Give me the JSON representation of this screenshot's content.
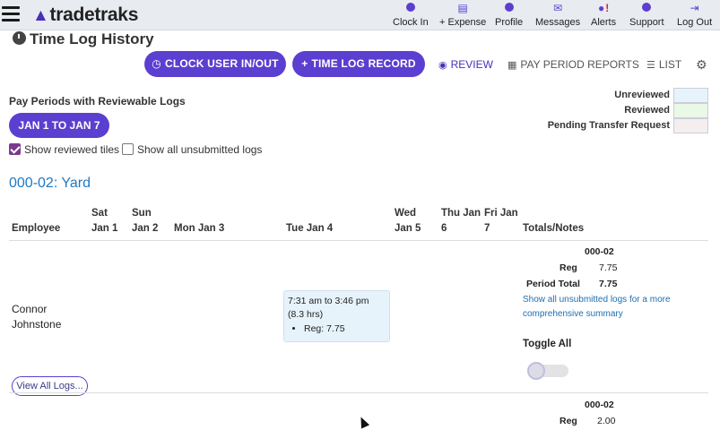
{
  "app": {
    "logo_text": "tradetraks"
  },
  "nav": [
    {
      "label": "Clock In",
      "icon": "clock-icon"
    },
    {
      "label": "+ Expense",
      "icon": "receipt-icon"
    },
    {
      "label": "Profile",
      "icon": "user-icon"
    },
    {
      "label": "Messages",
      "icon": "envelope-icon"
    },
    {
      "label": "Alerts",
      "icon": "bell-icon",
      "badge": "!"
    },
    {
      "label": "Support",
      "icon": "question-icon"
    },
    {
      "label": "Log Out",
      "icon": "logout-icon"
    }
  ],
  "page": {
    "title": "Time Log History"
  },
  "actions": {
    "clock_user": "CLOCK USER IN/OUT",
    "time_log_record": "TIME LOG RECORD",
    "review": "REVIEW",
    "pay_period_reports": "PAY PERIOD REPORTS",
    "list": "LIST"
  },
  "pay_periods": {
    "label": "Pay Periods with Reviewable Logs",
    "selected": "JAN 1 TO JAN 7",
    "show_reviewed": "Show reviewed tiles",
    "show_unsubmitted": "Show all unsubmitted logs",
    "show_reviewed_checked": true,
    "show_unsubmitted_checked": false
  },
  "legend": [
    {
      "label": "Unreviewed",
      "color": "#e6f3fb"
    },
    {
      "label": "Reviewed",
      "color": "#eaf8e6"
    },
    {
      "label": "Pending Transfer Request",
      "color": "#f4eeee"
    }
  ],
  "project": {
    "name": "000-02: Yard"
  },
  "table": {
    "headers": {
      "employee": "Employee",
      "sat": [
        "Sat",
        "Jan 1"
      ],
      "sun": [
        "Sun",
        "Jan 2"
      ],
      "mon": "Mon Jan 3",
      "tue": "Tue Jan 4",
      "wed": [
        "Wed",
        "Jan 5"
      ],
      "thu": [
        "Thu Jan",
        "6"
      ],
      "fri": [
        "Fri Jan",
        "7"
      ],
      "totals": "Totals/Notes"
    },
    "row": {
      "employee_first": "Connor",
      "employee_last": "Johnstone",
      "tue_log": "7:31 am to 3:46 pm (8.3 hrs)",
      "tue_reg": "Reg: 7.75",
      "totals_code": "000-02",
      "reg_label": "Reg",
      "reg_value": "7.75",
      "period_total_label": "Period Total",
      "period_total_value": "7.75",
      "summary_link": "Show all unsubmitted logs for a more comprehensive summary",
      "toggle_all": "Toggle All",
      "view_all": "View All Logs..."
    },
    "next_row": {
      "totals_code": "000-02",
      "reg_label": "Reg",
      "reg_value": "2.00"
    }
  }
}
